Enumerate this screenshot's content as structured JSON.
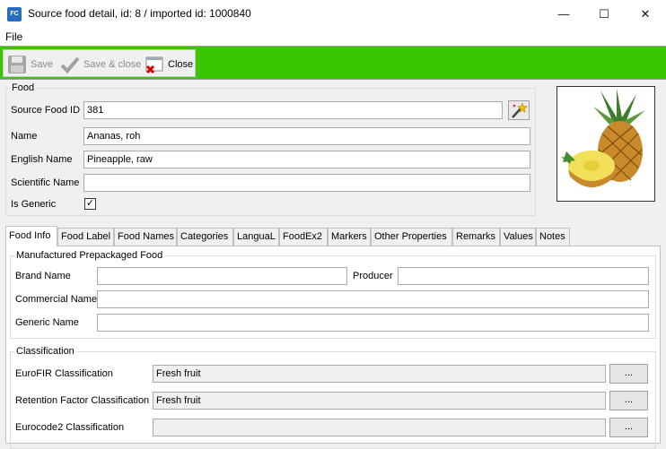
{
  "window": {
    "title": "Source food detail, id: 8 / imported id: 1000840",
    "app_icon": "FC",
    "minimize": "—",
    "maximize": "☐",
    "close": "✕"
  },
  "menu": {
    "file": "File"
  },
  "toolbar": {
    "save": "Save",
    "save_close": "Save & close",
    "close": "Close"
  },
  "food": {
    "legend": "Food",
    "source_food_id_label": "Source Food ID",
    "source_food_id": "381",
    "name_label": "Name",
    "name": "Ananas, roh",
    "english_name_label": "English Name",
    "english_name": "Pineapple, raw",
    "scientific_name_label": "Scientific Name",
    "scientific_name": "",
    "is_generic_label": "Is Generic",
    "is_generic": true
  },
  "tabs": [
    "Food Info",
    "Food Label",
    "Food Names",
    "Categories",
    "LanguaL",
    "FoodEx2",
    "Markers",
    "Other Properties",
    "Remarks",
    "Values",
    "Notes"
  ],
  "food_info": {
    "manufactured_legend": "Manufactured Prepackaged Food",
    "brand_name_label": "Brand Name",
    "brand_name": "",
    "producer_label": "Producer",
    "producer": "",
    "commercial_name_label": "Commercial Name",
    "commercial_name": "",
    "generic_name_label": "Generic Name",
    "generic_name": "",
    "classification_legend": "Classification",
    "eurofir_label": "EuroFIR Classification",
    "eurofir": "Fresh fruit",
    "retention_label": "Retention Factor Classification",
    "retention": "Fresh fruit",
    "eurocode2_label": "Eurocode2 Classification",
    "eurocode2": "",
    "browse": "..."
  }
}
